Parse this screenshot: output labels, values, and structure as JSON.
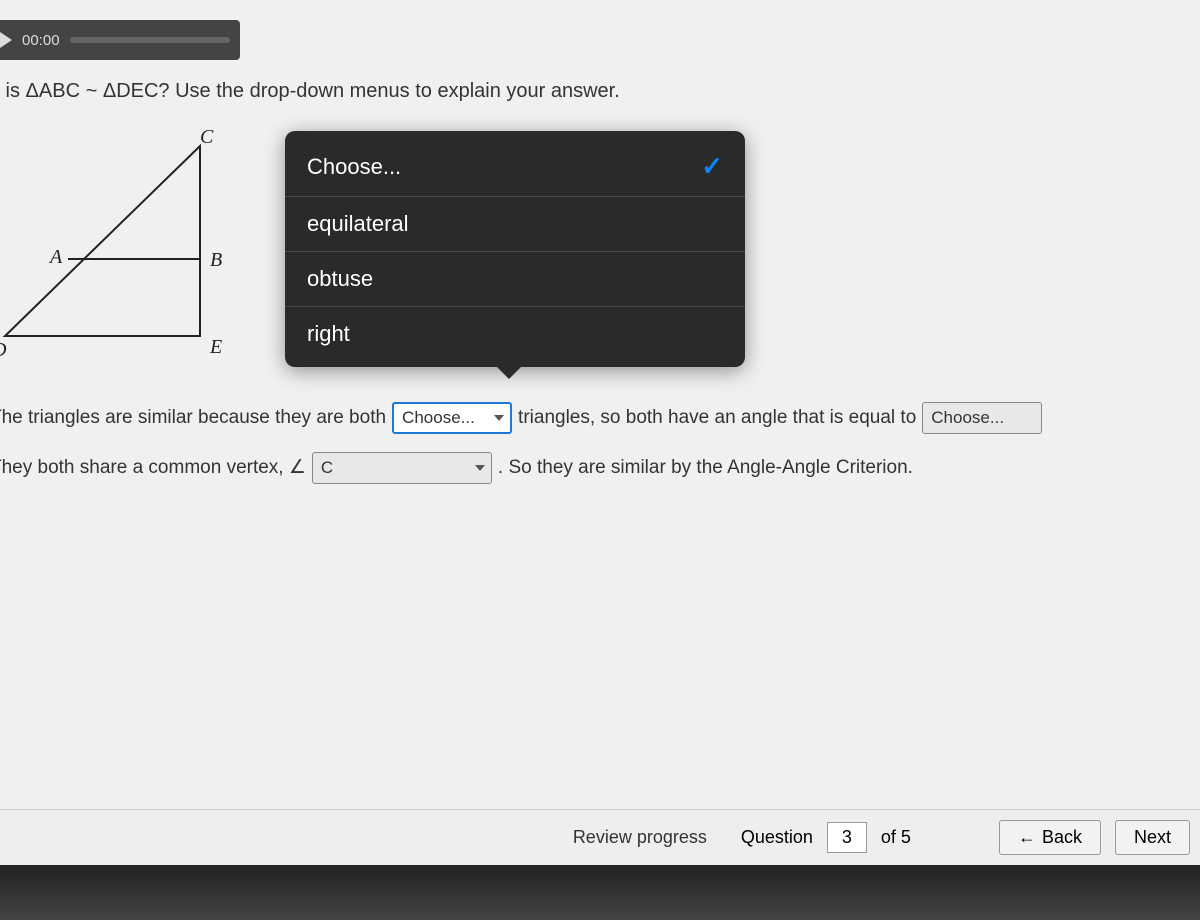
{
  "video": {
    "time": "00:00"
  },
  "question": "y is ΔABC ~ ΔDEC? Use the drop-down menus to explain your answer.",
  "diagram": {
    "labels": {
      "C": "C",
      "A": "A",
      "B": "B",
      "D": "D",
      "E": "E"
    }
  },
  "popover": {
    "options": [
      {
        "label": "Choose...",
        "selected": true
      },
      {
        "label": "equilateral",
        "selected": false
      },
      {
        "label": "obtuse",
        "selected": false
      },
      {
        "label": "right",
        "selected": false
      }
    ]
  },
  "statement": {
    "part1": "The triangles are similar because they are both",
    "dd1": "Choose...",
    "part2": "triangles, so both have an angle that is equal to",
    "dd2": "Choose...",
    "part3": "They both share a common vertex, ∠",
    "dd3": "C",
    "part4": ". So they are similar by the Angle-Angle Criterion."
  },
  "footer": {
    "review": "Review progress",
    "questionLabel": "Question",
    "current": "3",
    "of": "of 5",
    "back": "Back",
    "next": "Next"
  }
}
